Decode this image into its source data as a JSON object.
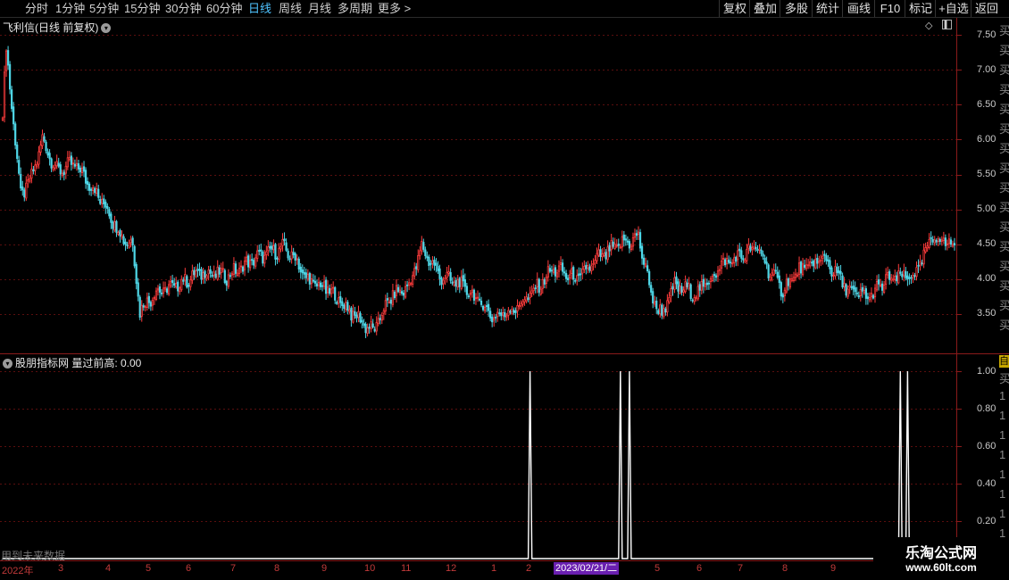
{
  "topbar": {
    "periods": [
      "分时",
      "1分钟",
      "5分钟",
      "15分钟",
      "30分钟",
      "60分钟",
      "日线",
      "周线",
      "月线",
      "多周期",
      "更多 >"
    ],
    "active": "日线",
    "actions": [
      "复权",
      "叠加",
      "多股",
      "统计",
      "画线",
      "F10",
      "标记",
      "+自选",
      "返回"
    ]
  },
  "main_panel": {
    "title": "飞利信(日线 前复权)",
    "y_ticks": [
      "7.50",
      "7.00",
      "6.50",
      "6.00",
      "5.50",
      "5.00",
      "4.50",
      "4.00",
      "3.50"
    ],
    "side_chars": [
      "买",
      "买",
      "买",
      "买",
      "买",
      "买",
      "买",
      "买",
      "买",
      "买",
      "买",
      "买",
      "买",
      "买",
      "买",
      "买"
    ]
  },
  "indicator_panel": {
    "title": "股朋指标网 量过前高: 0.00",
    "y_ticks": [
      "1.00",
      "0.80",
      "0.60",
      "0.40",
      "0.20"
    ],
    "side_label": "自",
    "side_chars": [
      "买",
      "1",
      "1",
      "1",
      "1",
      "1",
      "1",
      "1",
      "1"
    ],
    "future_note": "用到未来数据"
  },
  "xaxis": {
    "labels": [
      "2022年",
      "3",
      "4",
      "5",
      "6",
      "7",
      "8",
      "9",
      "10",
      "11",
      "12",
      "1",
      "2",
      "2023/02/21/二",
      "5",
      "6",
      "7",
      "8",
      "9"
    ],
    "cursor_date": "2023/02/21/二"
  },
  "watermark": {
    "line1": "乐淘公式网",
    "line2": "www.60lt.com"
  },
  "colors": {
    "up": "#ff3c3c",
    "down": "#4fd6e6",
    "grid": "#5a0e0e",
    "axis": "#8a1a1a"
  },
  "chart_data": [
    {
      "type": "candlestick",
      "title": "飞利信(日线 前复权)",
      "ylim": [
        3.1,
        7.6
      ],
      "x_labels": [
        "2022年",
        "3",
        "4",
        "5",
        "6",
        "7",
        "8",
        "9",
        "10",
        "11",
        "12",
        "1",
        "2",
        "2023/02/21/二",
        "5",
        "6",
        "7",
        "8",
        "9"
      ],
      "close_anchors": [
        [
          0,
          6.4
        ],
        [
          2,
          7.3
        ],
        [
          5,
          6.5
        ],
        [
          10,
          5.2
        ],
        [
          16,
          5.45
        ],
        [
          22,
          6.0
        ],
        [
          30,
          5.55
        ],
        [
          40,
          5.65
        ],
        [
          50,
          5.3
        ],
        [
          58,
          5.0
        ],
        [
          66,
          4.6
        ],
        [
          72,
          4.5
        ],
        [
          76,
          3.55
        ],
        [
          84,
          3.8
        ],
        [
          95,
          3.9
        ],
        [
          110,
          4.1
        ],
        [
          125,
          4.05
        ],
        [
          140,
          4.3
        ],
        [
          155,
          4.45
        ],
        [
          162,
          4.3
        ],
        [
          168,
          4.0
        ],
        [
          180,
          3.85
        ],
        [
          192,
          3.55
        ],
        [
          205,
          3.25
        ],
        [
          215,
          3.75
        ],
        [
          225,
          3.9
        ],
        [
          232,
          4.45
        ],
        [
          242,
          4.05
        ],
        [
          255,
          3.9
        ],
        [
          265,
          3.65
        ],
        [
          272,
          3.45
        ],
        [
          285,
          3.6
        ],
        [
          295,
          3.85
        ],
        [
          305,
          4.15
        ],
        [
          318,
          4.0
        ],
        [
          330,
          4.3
        ],
        [
          342,
          4.5
        ],
        [
          352,
          4.6
        ],
        [
          360,
          3.7
        ],
        [
          365,
          3.5
        ],
        [
          372,
          3.9
        ],
        [
          385,
          3.8
        ],
        [
          398,
          4.2
        ],
        [
          410,
          4.35
        ],
        [
          418,
          4.45
        ],
        [
          425,
          4.1
        ],
        [
          432,
          3.85
        ],
        [
          440,
          4.1
        ],
        [
          455,
          4.3
        ],
        [
          465,
          3.95
        ],
        [
          470,
          3.8
        ],
        [
          480,
          3.75
        ],
        [
          490,
          4.0
        ],
        [
          505,
          4.05
        ],
        [
          515,
          4.6
        ],
        [
          522,
          4.55
        ],
        [
          527,
          4.45
        ]
      ]
    },
    {
      "type": "line",
      "title": "量过前高",
      "ylim": [
        0,
        1.0
      ],
      "spikes_at_day": [
        292,
        342,
        347,
        497,
        501
      ],
      "baseline": 0
    }
  ]
}
